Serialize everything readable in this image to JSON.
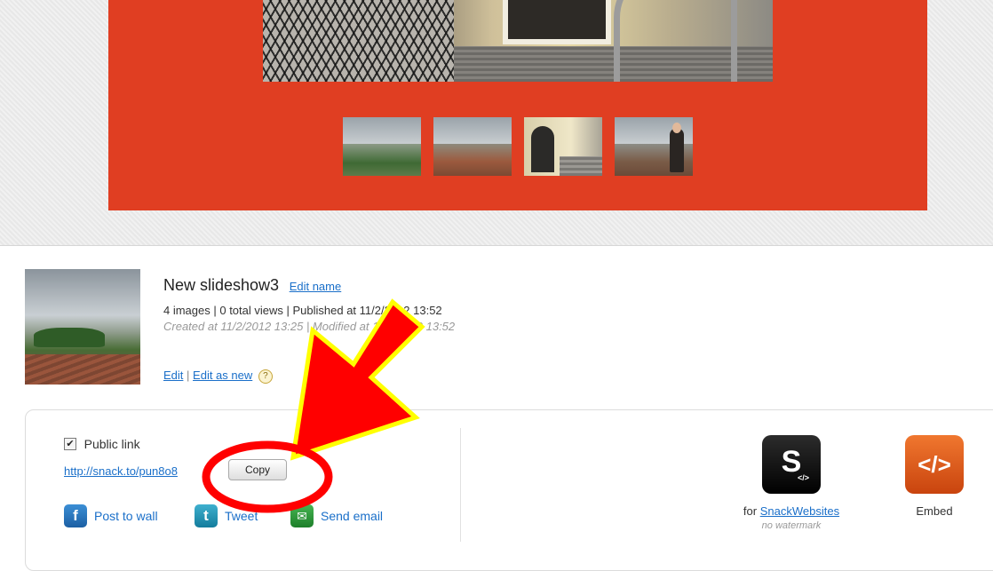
{
  "slideshow": {
    "title": "New slideshow3",
    "edit_name_label": "Edit name",
    "meta": "4 images | 0 total views | Published at 11/2/2012 13:52",
    "dates": "Created at 11/2/2012 13:25 | Modified at 11/2/2012 13:52",
    "edit_label": "Edit",
    "separator": "|",
    "edit_as_new_label": "Edit as new",
    "help_glyph": "?"
  },
  "share": {
    "public_checked_glyph": "✔",
    "public_link_label": "Public link",
    "link_url": "http://snack.to/pun8o8",
    "copy_label": "Copy",
    "post_to_wall_label": "Post to wall",
    "tweet_label": "Tweet",
    "send_email_label": "Send email",
    "facebook_glyph": "f",
    "twitter_glyph": "t",
    "email_glyph": "✉"
  },
  "publish_options": {
    "snack_glyph": "S",
    "snack_sub_glyph": "</>",
    "snack_prefix": "for",
    "snack_link": "SnackWebsites",
    "snack_note": "no watermark",
    "embed_glyph": "</>",
    "embed_label": "Embed"
  },
  "icons": [
    "help-icon",
    "facebook-icon",
    "twitter-icon",
    "email-icon",
    "snackwebsites-icon",
    "embed-code-icon"
  ],
  "colors": {
    "stage_red": "#e03e22",
    "link_blue": "#1a6fc9",
    "annotation_red": "#ff0000",
    "annotation_outline": "#ffff00"
  }
}
